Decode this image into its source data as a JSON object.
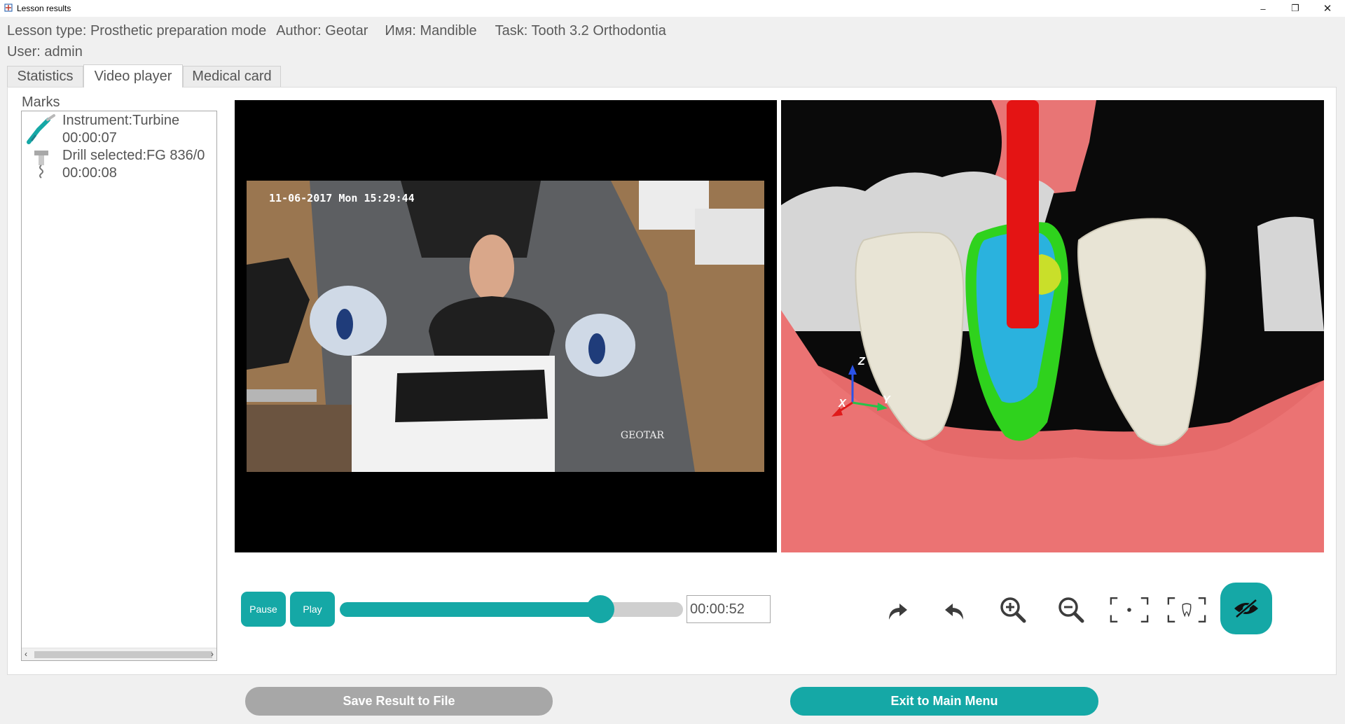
{
  "window": {
    "title": "Lesson results",
    "minimize": "–",
    "maximize": "❐",
    "close": "✕"
  },
  "lesson": {
    "type": "Lesson type: Prosthetic preparation mode",
    "author": "Author: Geotar",
    "name": "Имя: Mandible",
    "task": "Task: Tooth 3.2 Orthodontia",
    "user": "User: admin"
  },
  "tabs": [
    {
      "label": "Statistics",
      "active": false
    },
    {
      "label": "Video player",
      "active": true
    },
    {
      "label": "Medical card",
      "active": false
    }
  ],
  "marks": {
    "label": "Marks",
    "items": [
      {
        "title": "Instrument:Turbine",
        "time": "00:00:07",
        "icon": "turbine-icon"
      },
      {
        "title": "Drill selected:FG 836/0",
        "time": "00:00:08",
        "icon": "drill-icon"
      }
    ]
  },
  "video": {
    "timestamp": "11-06-2017 Mon 15:29:44",
    "brand": "GEOTAR"
  },
  "model": {
    "axes": {
      "x": "X",
      "y": "Y",
      "z": "Z"
    }
  },
  "player": {
    "pause_label": "Pause",
    "play_label": "Play",
    "progress": 0.76,
    "time": "00:00:52"
  },
  "toolbar_icons": [
    "redo-icon",
    "undo-icon",
    "zoom-in-icon",
    "zoom-out-icon",
    "fit-view-icon",
    "fit-tooth-icon",
    "hide-icon"
  ],
  "colors": {
    "accent": "#15a8a6",
    "save_button": "#a7a7a7",
    "gum": "#e86e6e",
    "tooth": "#e6e2d2",
    "drill": "#e41414",
    "prep_blue": "#2ab2de",
    "prep_green": "#2fd21d"
  },
  "footer": {
    "save_label": "Save Result to File",
    "exit_label": "Exit to Main Menu"
  }
}
